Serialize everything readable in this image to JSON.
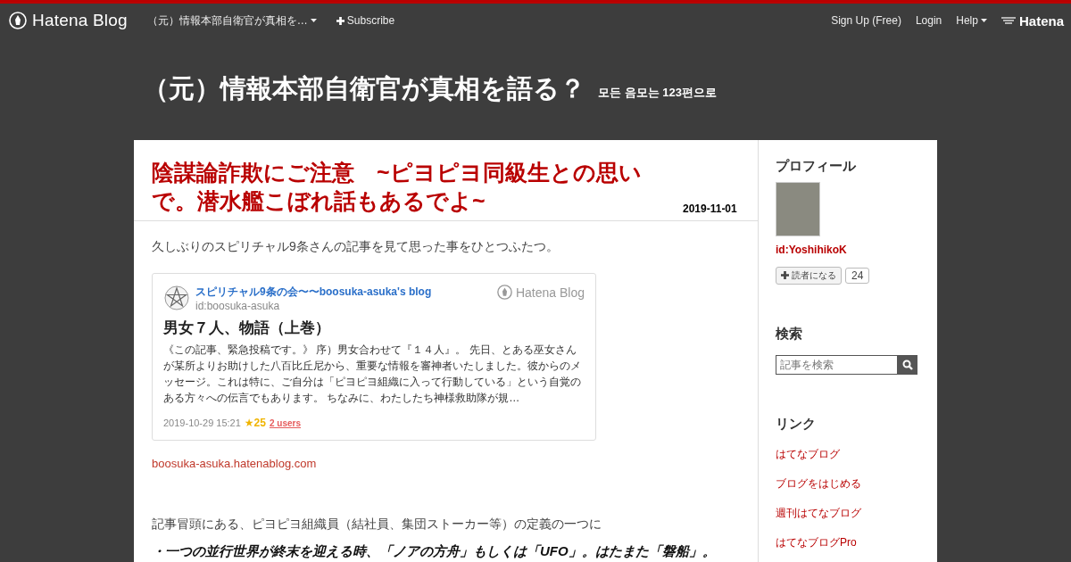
{
  "topbar": {
    "brand": "Hatena Blog",
    "blog_menu": "（元）情報本部自衛官が真相を…",
    "subscribe": "Subscribe",
    "links": [
      "Sign Up (Free)",
      "Login"
    ],
    "help": "Help",
    "hatena": "Hatena"
  },
  "header": {
    "title": "（元）情報本部自衛官が真相を語る？",
    "subtitle": "모든 음모는 123편으로"
  },
  "article": {
    "title": "陰謀論詐欺にご注意　~ピヨピヨ同級生との思いで。潜水艦こぼれ話もあるでよ~",
    "date": "2019-11-01",
    "intro": "久しぶりのスピリチャル9条さんの記事を見て思った事をひとつふたつ。",
    "embed": {
      "blog_name": "スピリチャル9条の会〜〜boosuka-asuka's blog",
      "blog_id": "id:boosuka-asuka",
      "service": "Hatena Blog",
      "title": "男女７人、物語（上巻）",
      "excerpt": "《この記事、緊急投稿です。》 序）男女合わせて『１４人』。 先日、とある巫女さんが某所よりお助けした八百比丘尼から、重要な情報を審神者いたしました。彼からのメッセージ。これは特に、ご自分は「ピヨピヨ組織に入って行動している」という自覚のある方々への伝言でもあります。 ちなみに、わたしたち神様救助隊が規…",
      "datetime": "2019-10-29 15:21",
      "stars": "★25",
      "users": "2 users"
    },
    "source_link": "boosuka-asuka.hatenablog.com",
    "paragraph": "記事冒頭にある、ピヨピヨ組織員（結社員、集団ストーカー等）の定義の一つに",
    "quote": "・一つの並行世界が終末を迎える時、「ノアの方舟」もしくは「UFO」。はたまた「磐船」。"
  },
  "sidebar": {
    "profile_heading": "プロフィール",
    "user_id": "id:YoshihikoK",
    "subscribe_button": "読者になる",
    "subscriber_count": "24",
    "search_heading": "検索",
    "search_placeholder": "記事を検索",
    "links_heading": "リンク",
    "links": [
      "はてなブログ",
      "ブログをはじめる",
      "週刊はてなブログ",
      "はてなブログPro"
    ]
  }
}
